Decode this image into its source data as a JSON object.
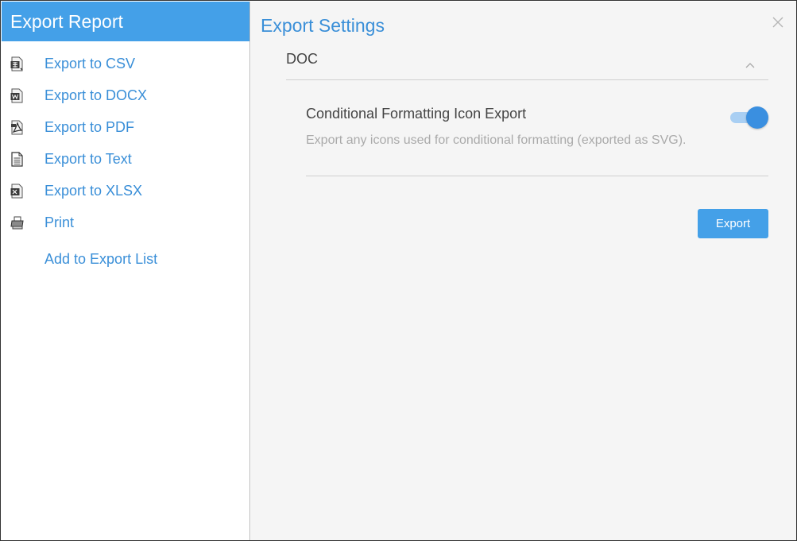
{
  "colors": {
    "accent": "#44a0e8",
    "link": "#3a8fd8",
    "toggle_on": "#3a8fe0",
    "toggle_track": "#a9cff3",
    "right_bg": "#f5f5f5"
  },
  "left_panel": {
    "title": "Export Report",
    "items": [
      {
        "label": "Export to CSV",
        "icon": "csv-file-icon"
      },
      {
        "label": "Export to DOCX",
        "icon": "docx-file-icon"
      },
      {
        "label": "Export to PDF",
        "icon": "pdf-file-icon"
      },
      {
        "label": "Export to Text",
        "icon": "text-file-icon"
      },
      {
        "label": "Export to XLSX",
        "icon": "xlsx-file-icon"
      },
      {
        "label": "Print",
        "icon": "printer-icon"
      },
      {
        "label": "Add to Export List",
        "icon": ""
      }
    ]
  },
  "right_panel": {
    "title": "Export Settings",
    "close_icon": "close-icon",
    "section": {
      "title": "DOC",
      "collapse_icon": "chevron-up-icon",
      "expanded": true
    },
    "setting": {
      "label": "Conditional Formatting Icon Export",
      "description": "Export any icons used for conditional formatting (exported as SVG).",
      "enabled": true
    },
    "export_button": "Export"
  }
}
